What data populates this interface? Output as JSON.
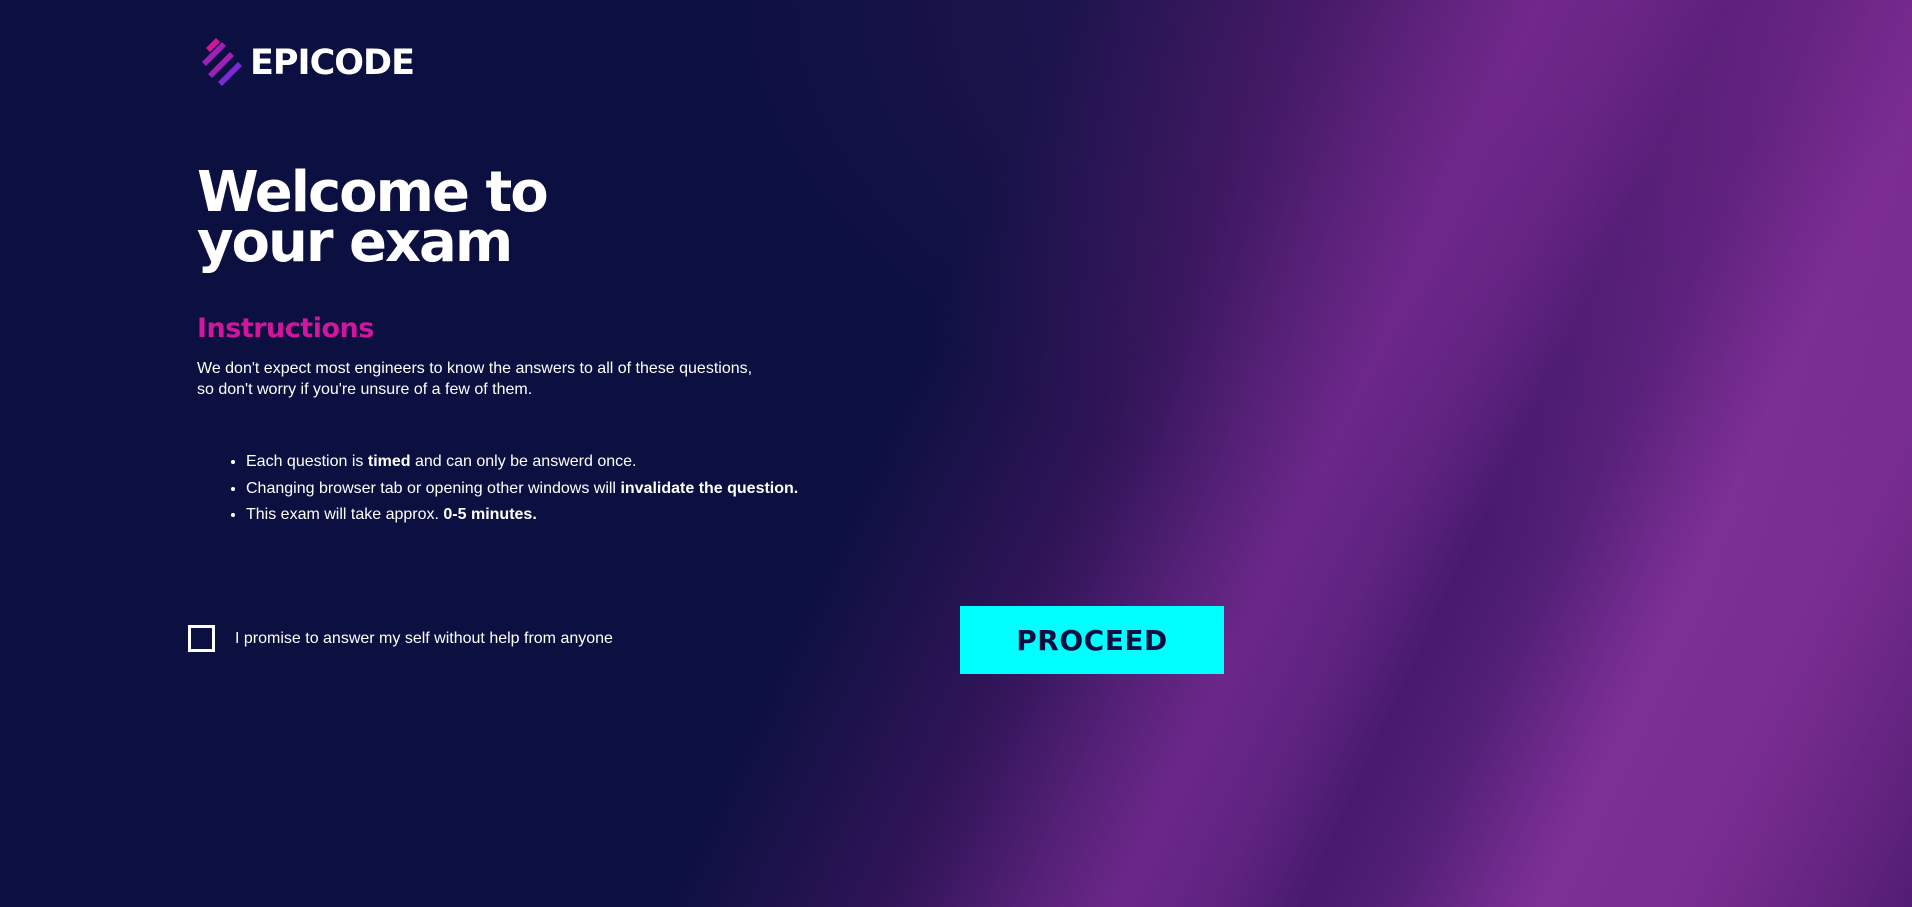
{
  "brand": {
    "name": "EPICODE",
    "logo_icon": "epicode-stripes-icon"
  },
  "page": {
    "title_line1": "Welcome to",
    "title_line2": "your exam"
  },
  "instructions": {
    "heading": "Instructions",
    "intro": "We don't expect most engineers to know the answers to all of these questions, so don't worry if you're unsure of a few of them.",
    "rules": [
      {
        "before": "Each question is ",
        "bold": "timed",
        "after": " and can only be answerd once."
      },
      {
        "before": "Changing browser tab or opening other windows will ",
        "bold": "invalidate the question.",
        "after": ""
      },
      {
        "before": "This exam will take approx. ",
        "bold": "0-5 minutes.",
        "after": ""
      }
    ]
  },
  "agreement": {
    "label": "I promise to answer my self without help from anyone",
    "checked": false
  },
  "actions": {
    "proceed_label": "PROCEED"
  },
  "colors": {
    "background": "#0b1040",
    "accent_heading": "#d1159c",
    "button": "#00ffff",
    "gradient_purple": "#7a2f8f"
  }
}
